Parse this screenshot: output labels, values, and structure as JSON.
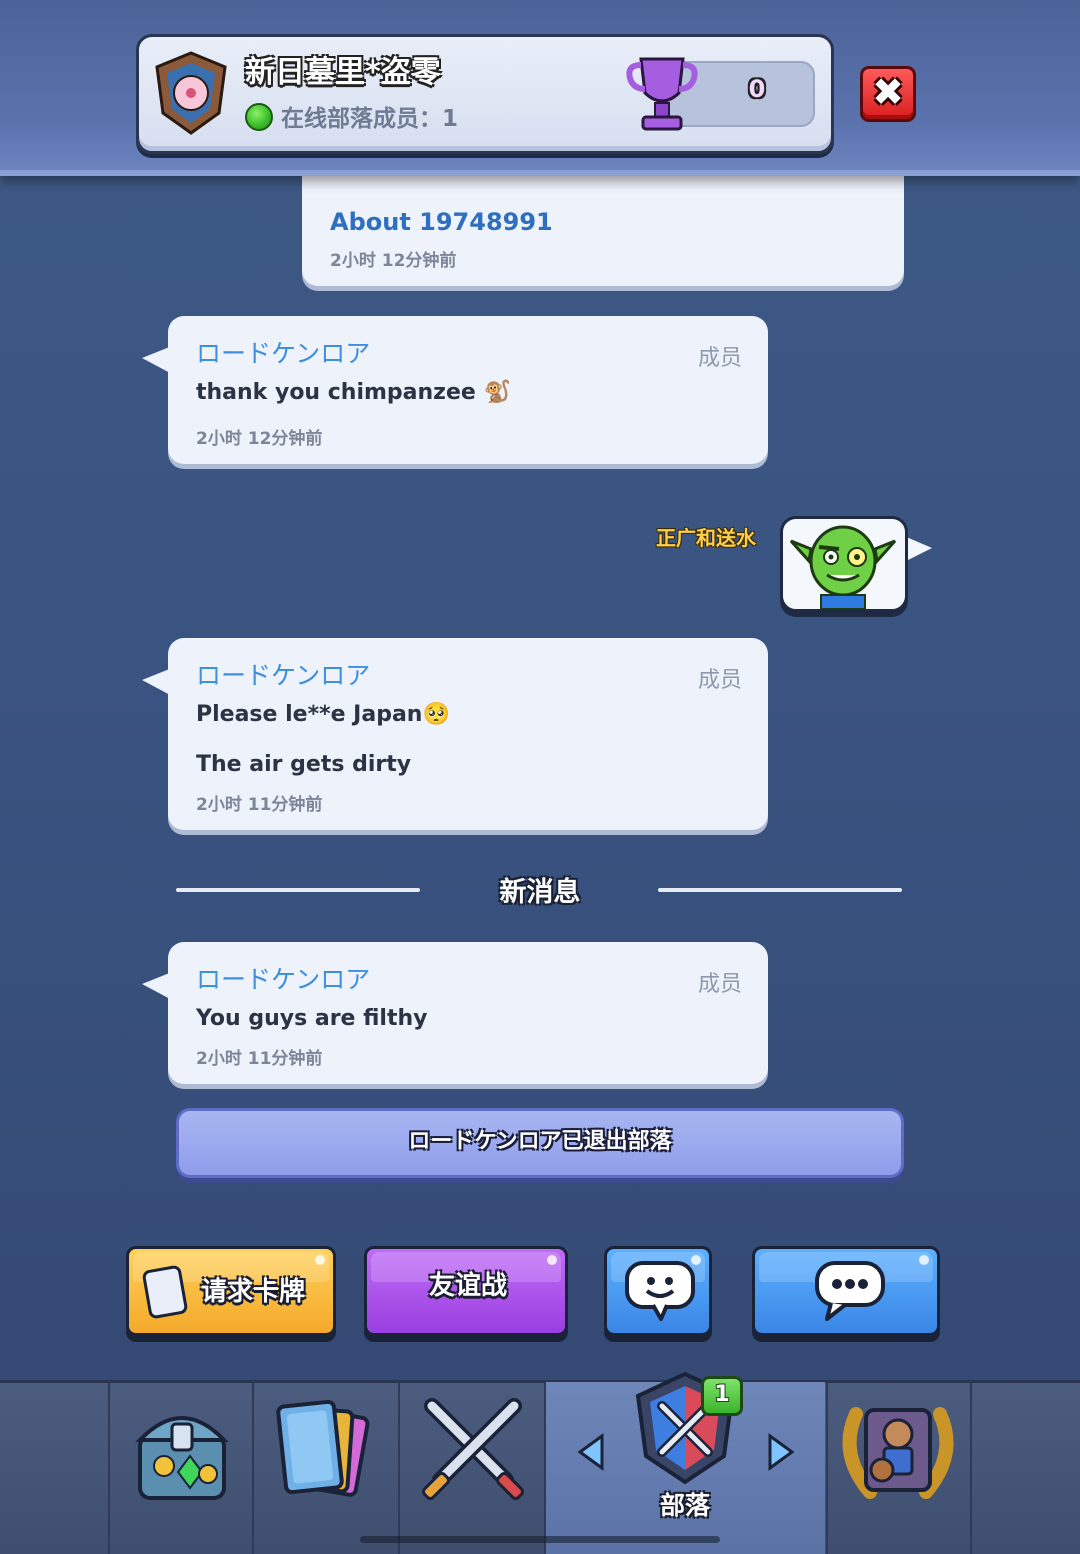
{
  "header": {
    "clan_name": "新日墓里*盗零",
    "online_label": "在线部落成员：1",
    "trophies": "0",
    "close_label": "✖"
  },
  "about_message": {
    "title": "About 19748991",
    "time": "2小时 12分钟前"
  },
  "messages": [
    {
      "sender": "ロードケンロア",
      "role": "成员",
      "lines": [
        "thank you chimpanzee 🐒"
      ],
      "time": "2小时 12分钟前"
    },
    {
      "sender": "ロードケンロア",
      "role": "成员",
      "lines": [
        "Please le**e Japan🥺",
        "The air gets dirty"
      ],
      "time": "2小时 11分钟前"
    },
    {
      "sender": "ロードケンロア",
      "role": "成员",
      "lines": [
        "You guys are filthy"
      ],
      "time": "2小时 11分钟前"
    }
  ],
  "emote": {
    "sender": "正广和送水",
    "icon": "goblin-emote-icon"
  },
  "divider": {
    "label": "新消息"
  },
  "system_notice": "ロードケンロア已退出部落",
  "actions": {
    "request_cards": "请求卡牌",
    "friendly_battle": "友谊战",
    "emote_icon": "smiley-chat-icon",
    "chat_icon": "speech-bubble-icon"
  },
  "nav": {
    "active_label": "部落",
    "clan_badge_count": "1",
    "items": [
      "shop-chest-icon",
      "cards-icon",
      "battle-swords-icon",
      "clan-icon",
      "events-laurel-icon"
    ]
  },
  "colors": {
    "sender_blue": "#3f8fe0",
    "request_button": "#f4b83a",
    "friendly_button": "#a24de6",
    "chat_button": "#3f8fe8",
    "online_green": "#3cbf2b",
    "close_red": "#d81f1f"
  }
}
